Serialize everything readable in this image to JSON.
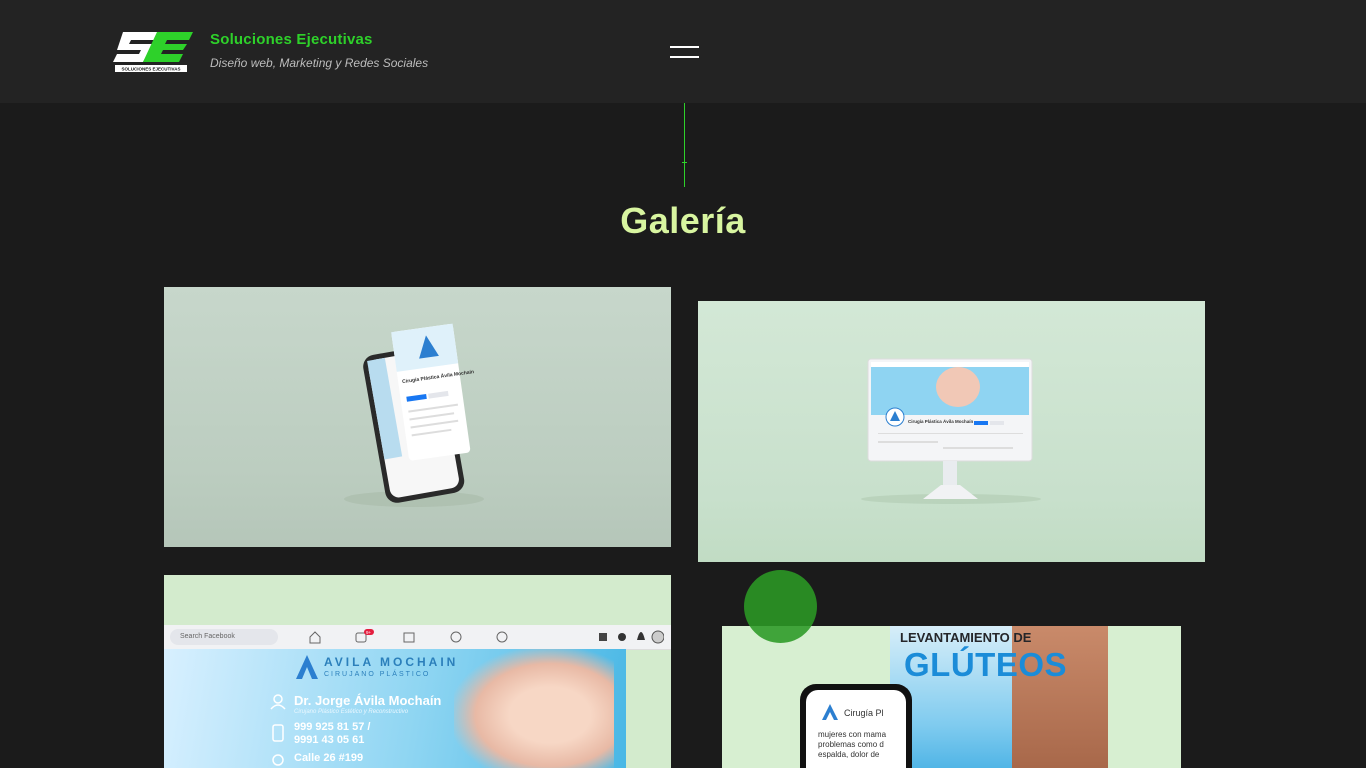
{
  "brand": {
    "title": "Soluciones Ejecutivas",
    "subtitle": "Diseño web, Marketing y Redes Sociales",
    "logo_text": "SOLUCIONES EJECUTIVAS"
  },
  "menu": {
    "icon": "hamburger-menu-icon"
  },
  "section": {
    "title": "Galería"
  },
  "colors": {
    "accent": "#2ed12a",
    "title": "#d8f5a0",
    "background": "#1b1b1b",
    "header": "#232323"
  },
  "gallery": {
    "card1": {
      "page_title": "Cirugía Plástica Ávila Mochaín"
    },
    "card2": {
      "page_title": "Cirugía Plástica Ávila Mochaín"
    },
    "card3": {
      "search": "Search Facebook",
      "badge": "9+",
      "brand": "AVILA MOCHAIN",
      "brand_sub": "CIRUJANO PLÁSTICO",
      "doctor": "Dr. Jorge Ávila Mochaín",
      "role": "Cirujano Plástico Estético y Reconstructivo",
      "phone1": "999 925 81 57 /",
      "phone2": "9991 43 05 61",
      "address": "Calle 26 #199"
    },
    "card4": {
      "ad_line1": "LEVANTAMIENTO DE",
      "ad_line2": "GLÚTEOS",
      "phone_title": "Cirugía Pl",
      "phone_text": "mujeres con mama problemas como d espalda, dolor de"
    }
  }
}
